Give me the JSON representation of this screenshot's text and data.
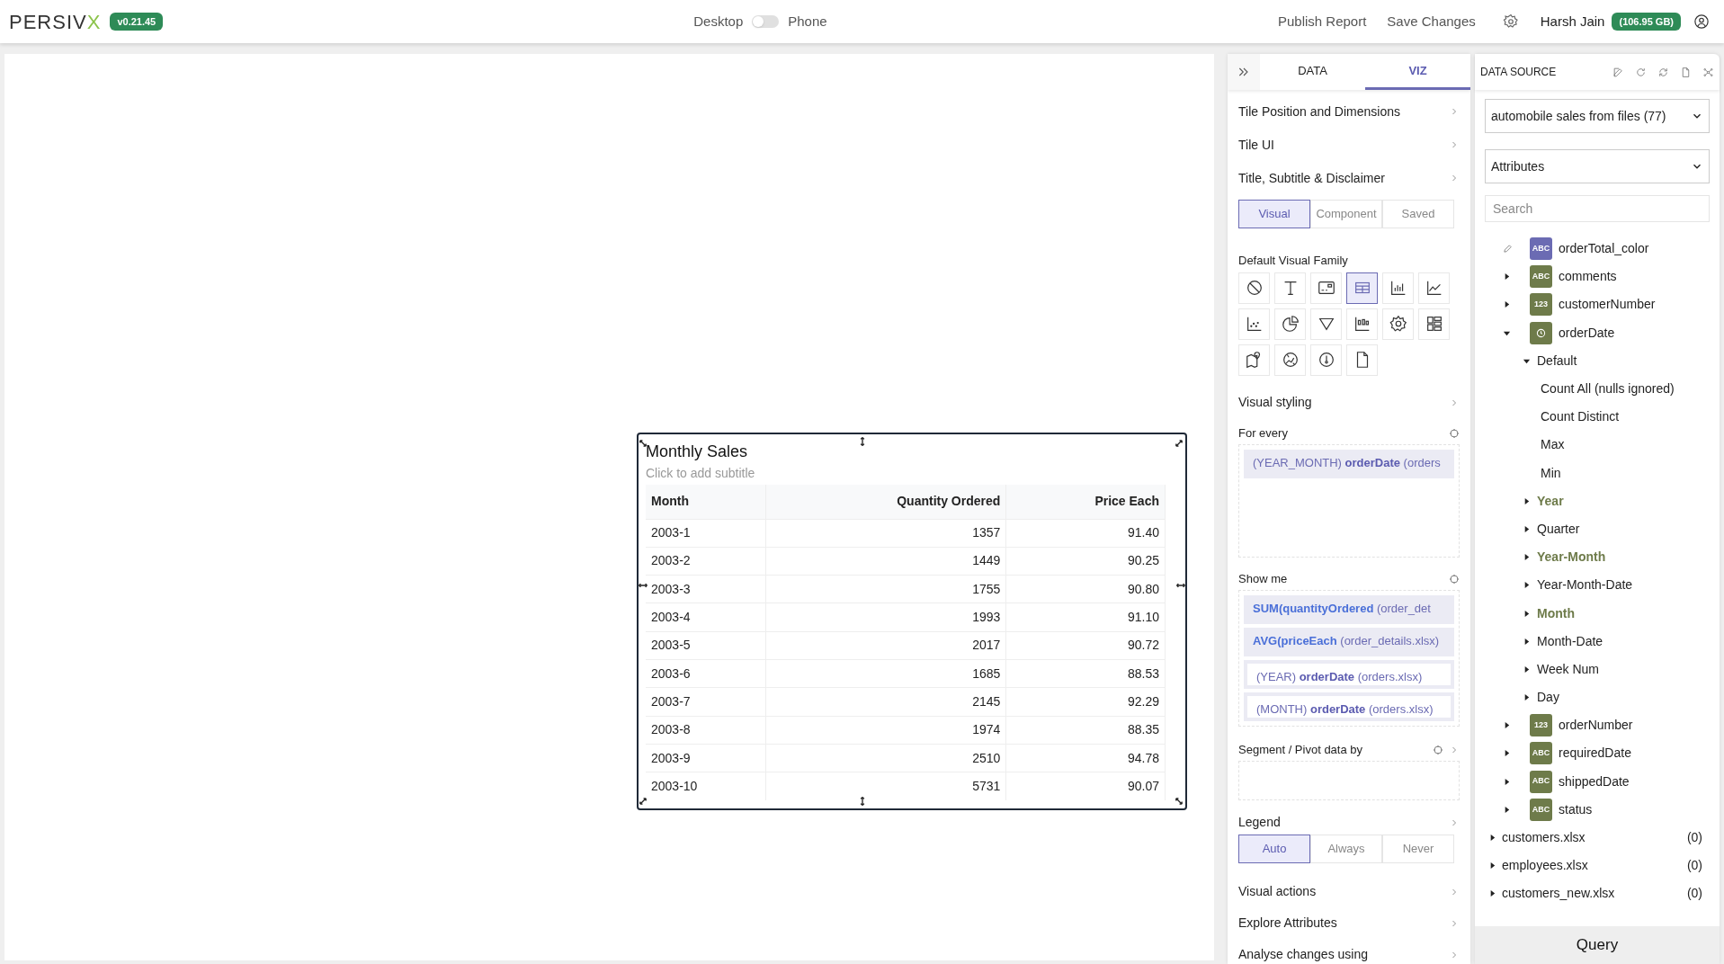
{
  "header": {
    "logo": {
      "text": "PERSIV",
      "accent": "X"
    },
    "version": "v0.21.45",
    "view_toggle": {
      "left": "Desktop",
      "right": "Phone",
      "on": false
    },
    "actions": [
      "Publish Report",
      "Save Changes"
    ],
    "user": {
      "name": "Harsh Jain",
      "storage": "(106.95 GB)"
    }
  },
  "tile": {
    "title": "Monthly Sales",
    "subtitle_placeholder": "Click to add subtitle",
    "columns": [
      {
        "label": "Month",
        "numeric": false
      },
      {
        "label": "Quantity Ordered",
        "numeric": true
      },
      {
        "label": "Price Each",
        "numeric": true
      }
    ],
    "rows": [
      [
        "2003-1",
        "1357",
        "91.40"
      ],
      [
        "2003-2",
        "1449",
        "90.25"
      ],
      [
        "2003-3",
        "1755",
        "90.80"
      ],
      [
        "2003-4",
        "1993",
        "91.10"
      ],
      [
        "2003-5",
        "2017",
        "90.72"
      ],
      [
        "2003-6",
        "1685",
        "88.53"
      ],
      [
        "2003-7",
        "2145",
        "92.29"
      ],
      [
        "2003-8",
        "1974",
        "88.35"
      ],
      [
        "2003-9",
        "2510",
        "94.78"
      ],
      [
        "2003-10",
        "5731",
        "90.07"
      ]
    ]
  },
  "viz_panel": {
    "tabs": [
      {
        "label": "DATA",
        "selected": false
      },
      {
        "label": "VIZ",
        "selected": true
      }
    ],
    "sections_top": [
      "Tile Position and Dimensions",
      "Tile UI",
      "Title, Subtitle & Disclaimer"
    ],
    "modes": [
      {
        "label": "Visual",
        "selected": true
      },
      {
        "label": "Component",
        "selected": false
      },
      {
        "label": "Saved",
        "selected": false
      }
    ],
    "visual_family": {
      "label": "Default Visual Family",
      "icons": [
        {
          "kind": "none",
          "selected": false
        },
        {
          "kind": "text",
          "selected": false
        },
        {
          "kind": "card",
          "selected": false
        },
        {
          "kind": "table",
          "selected": true
        },
        {
          "kind": "bar",
          "selected": false
        },
        {
          "kind": "line",
          "selected": false
        },
        {
          "kind": "scatter",
          "selected": false
        },
        {
          "kind": "pie",
          "selected": false
        },
        {
          "kind": "funnel",
          "selected": false
        },
        {
          "kind": "boxplot",
          "selected": false
        },
        {
          "kind": "gear",
          "selected": false
        },
        {
          "kind": "layout",
          "selected": false
        },
        {
          "kind": "map",
          "selected": false
        },
        {
          "kind": "globe",
          "selected": false
        },
        {
          "kind": "gauge",
          "selected": false
        },
        {
          "kind": "file",
          "selected": false
        }
      ]
    },
    "visual_styling": "Visual styling",
    "for_every": {
      "label": "For every",
      "pills": [
        {
          "text": "(YEAR_MONTH) **orderDate** (orders",
          "kind": "dimension",
          "filled": true
        }
      ]
    },
    "show_me": {
      "label": "Show me",
      "pills": [
        {
          "text": "**SUM(quantityOrdered** (order_det",
          "kind": "measure",
          "filled": true
        },
        {
          "text": "**AVG(priceEach** (order_details.xlsx)",
          "kind": "measure",
          "filled": true
        },
        {
          "text": "(YEAR) **orderDate** (orders.xlsx)",
          "kind": "dimension",
          "filled": false
        },
        {
          "text": "(MONTH) **orderDate** (orders.xlsx)",
          "kind": "dimension",
          "filled": false
        }
      ]
    },
    "segment": {
      "label": "Segment / Pivot data by"
    },
    "legend": {
      "label": "Legend",
      "options": [
        {
          "label": "Auto",
          "selected": true
        },
        {
          "label": "Always",
          "selected": false
        },
        {
          "label": "Never",
          "selected": false
        }
      ]
    },
    "sections_bottom": [
      "Visual actions",
      "Explore Attributes",
      "Analyse changes using"
    ]
  },
  "data_source": {
    "title": "DATA SOURCE",
    "source": "automobile sales from files (77)",
    "view": "Attributes",
    "search": {
      "placeholder": "Search"
    },
    "fields": [
      {
        "name": "orderTotal_color",
        "badge": "ABC",
        "color": "#6b6bb3",
        "kind": "editable"
      },
      {
        "name": "comments",
        "badge": "ABC",
        "color": "#6e7b4a",
        "kind": "field",
        "expanded": false
      },
      {
        "name": "customerNumber",
        "badge": "123",
        "color": "#6e7b4a",
        "kind": "field",
        "expanded": false
      },
      {
        "name": "orderDate",
        "color": "#6e7b4a",
        "kind": "date",
        "expanded": true,
        "children": [
          {
            "label": "Default",
            "expanded": true,
            "used": false,
            "children": [
              {
                "label": "Count All (nulls ignored)"
              },
              {
                "label": "Count Distinct"
              },
              {
                "label": "Max"
              },
              {
                "label": "Min"
              }
            ]
          },
          {
            "label": "Year",
            "expanded": false,
            "used": true
          },
          {
            "label": "Quarter",
            "expanded": false,
            "used": false
          },
          {
            "label": "Year-Month",
            "expanded": false,
            "used": true
          },
          {
            "label": "Year-Month-Date",
            "expanded": false,
            "used": false
          },
          {
            "label": "Month",
            "expanded": false,
            "used": true
          },
          {
            "label": "Month-Date",
            "expanded": false,
            "used": false
          },
          {
            "label": "Week Num",
            "expanded": false,
            "used": false
          },
          {
            "label": "Day",
            "expanded": false,
            "used": false
          }
        ]
      },
      {
        "name": "orderNumber",
        "badge": "123",
        "color": "#6e7b4a",
        "kind": "field",
        "expanded": false
      },
      {
        "name": "requiredDate",
        "badge": "ABC",
        "color": "#6e7b4a",
        "kind": "field",
        "expanded": false
      },
      {
        "name": "shippedDate",
        "badge": "ABC",
        "color": "#6e7b4a",
        "kind": "field",
        "expanded": false
      },
      {
        "name": "status",
        "badge": "ABC",
        "color": "#6e7b4a",
        "kind": "field",
        "expanded": false
      }
    ],
    "files": [
      {
        "name": "customers.xlsx",
        "count": "(0)",
        "expanded": false
      },
      {
        "name": "employees.xlsx",
        "count": "(0)",
        "expanded": false
      },
      {
        "name": "customers_new.xlsx",
        "count": "(0)",
        "expanded": false
      }
    ],
    "query_button": "Query"
  }
}
